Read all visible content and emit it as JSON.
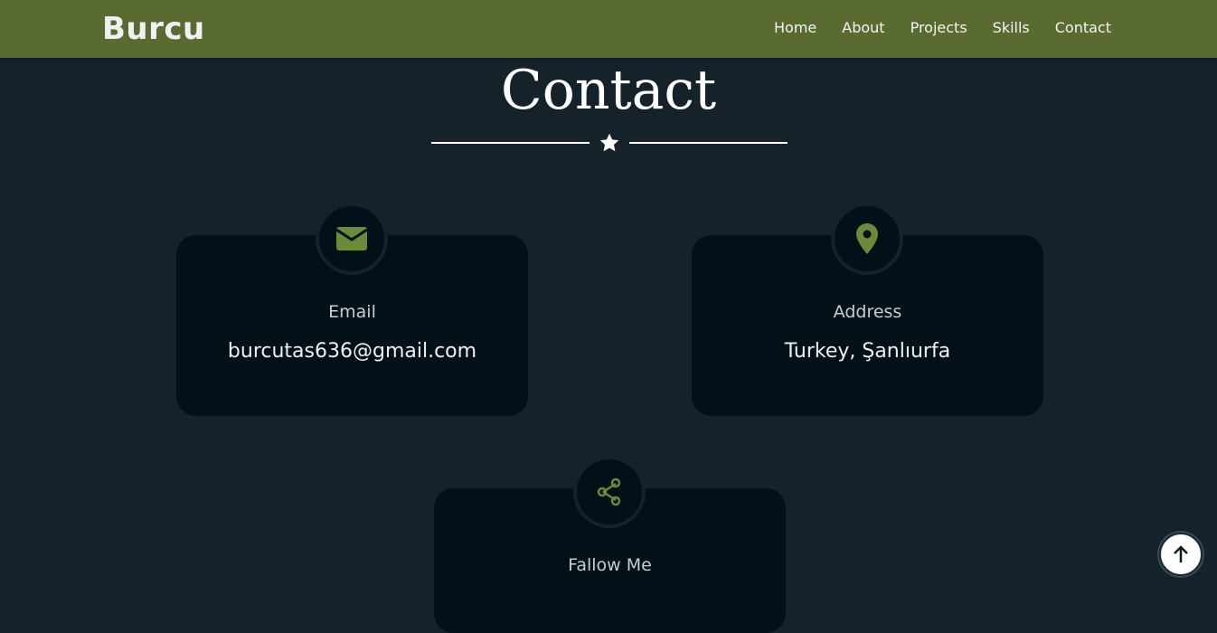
{
  "header": {
    "brand": "Burcu",
    "nav": [
      {
        "label": "Home"
      },
      {
        "label": "About"
      },
      {
        "label": "Projects"
      },
      {
        "label": "Skills"
      },
      {
        "label": "Contact"
      }
    ]
  },
  "section": {
    "title": "Contact",
    "divider_icon": "star-icon"
  },
  "cards": {
    "email": {
      "icon": "envelope-icon",
      "label": "Email",
      "value": "burcutas636@gmail.com"
    },
    "address": {
      "icon": "map-pin-icon",
      "label": "Address",
      "value": "Turkey, Şanlıurfa"
    },
    "follow": {
      "icon": "share-icon",
      "label": "Fallow Me"
    }
  },
  "scroll_top": {
    "icon": "arrow-up-icon"
  },
  "colors": {
    "navbar": "#5a6b32",
    "background": "#15222a",
    "card": "#011117",
    "accent": "#6b8a3a"
  }
}
